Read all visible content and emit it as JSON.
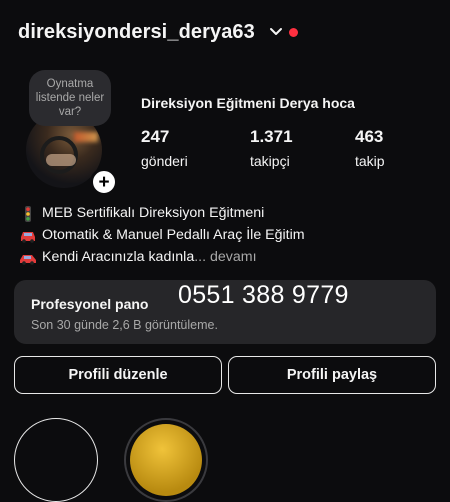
{
  "header": {
    "username": "direksiyondersi_derya63"
  },
  "profile": {
    "note": "Oynatma listende neler var?",
    "display_name": "Direksiyon Eğitmeni Derya hoca",
    "stats": [
      {
        "value": "247",
        "label": "gönderi"
      },
      {
        "value": "1.371",
        "label": "takipçi"
      },
      {
        "value": "463",
        "label": "takip"
      }
    ]
  },
  "bio": {
    "lines": [
      {
        "icon": "traffic-light-icon",
        "text": "MEB Sertifikalı Direksiyon Eğitmeni"
      },
      {
        "icon": "car-icon",
        "text": "Otomatik & Manuel Pedallı Araç İle Eğitim"
      },
      {
        "icon": "car-icon",
        "text": "Kendi Aracınızla kadınla"
      }
    ],
    "ellipsis": "...",
    "more": "devamı"
  },
  "dashboard": {
    "title": "Profesyonel pano",
    "subtitle": "Son 30 günde 2,6 B görüntüleme."
  },
  "overlay_phone": "0551 388 9779",
  "buttons": {
    "edit_profile": "Profili düzenle",
    "share_profile": "Profili paylaş"
  },
  "colors": {
    "background": "#0c0c0e",
    "live_dot": "#ff3040",
    "card": "#262629",
    "muted_text": "#a8a8a8"
  }
}
